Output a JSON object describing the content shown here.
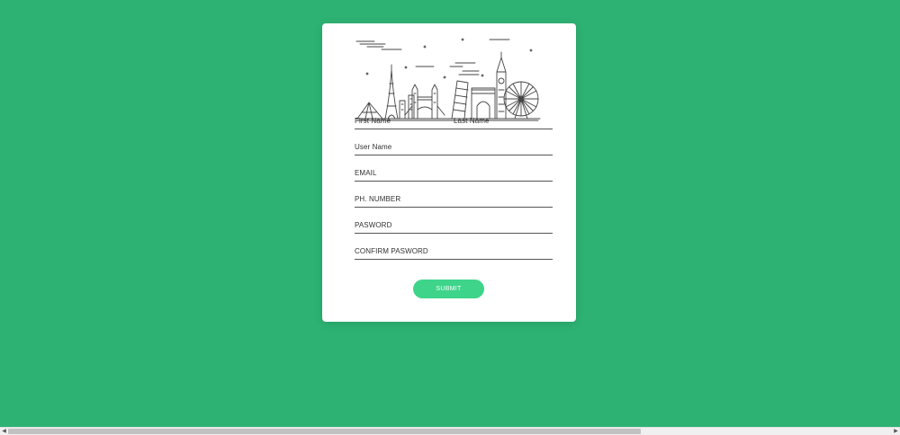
{
  "form": {
    "fields": {
      "first_name": {
        "label": "First Name",
        "value": ""
      },
      "last_name": {
        "label": "Last Name",
        "value": ""
      },
      "user_name": {
        "label": "User Name",
        "value": ""
      },
      "email": {
        "label": "EMAIL",
        "value": ""
      },
      "phone": {
        "label": "PH. NUMBER",
        "value": ""
      },
      "password": {
        "label": "PASWORD",
        "value": ""
      },
      "confirm_password": {
        "label": "CONFIRM PASWORD",
        "value": ""
      }
    },
    "submit_label": "SUBMIT"
  },
  "scrollbar": {
    "left_arrow": "◀",
    "right_arrow": "▶"
  },
  "colors": {
    "background": "#2db273",
    "card": "#ffffff",
    "button": "#3ed48a",
    "field_line": "#555555"
  },
  "icons": {
    "header_illustration": "city-skyline-illustration"
  }
}
